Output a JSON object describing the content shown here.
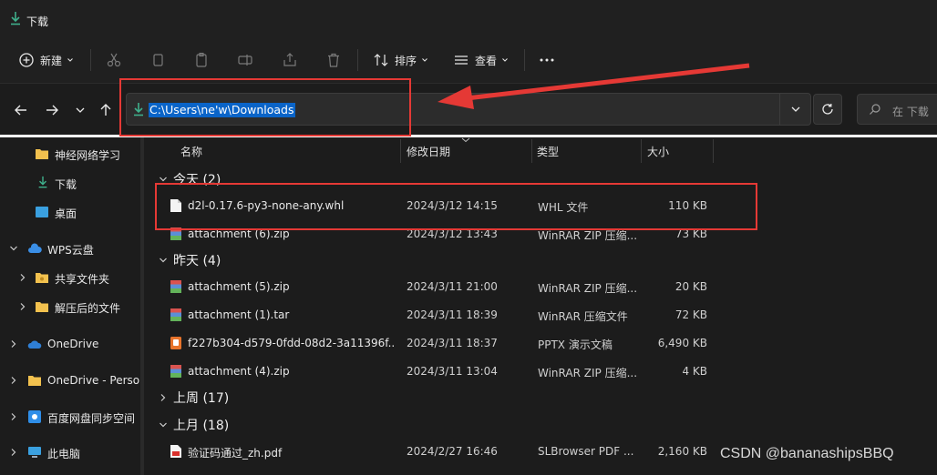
{
  "window": {
    "title": "下载"
  },
  "toolbar": {
    "new_label": "新建",
    "sort_label": "排序",
    "view_label": "查看"
  },
  "address": {
    "path": "C:\\Users\\ne'w\\Downloads"
  },
  "search": {
    "placeholder": "在 下载 "
  },
  "sidebar": {
    "items": [
      {
        "label": "神经网络学习",
        "icon": "folder-icon"
      },
      {
        "label": "下载",
        "icon": "download-icon"
      },
      {
        "label": "桌面",
        "icon": "desktop-icon"
      },
      {
        "label": "WPS云盘",
        "icon": "cloud-icon"
      },
      {
        "label": "共享文件夹",
        "icon": "shared-folder-icon"
      },
      {
        "label": "解压后的文件",
        "icon": "folder-icon"
      },
      {
        "label": "OneDrive",
        "icon": "onedrive-icon"
      },
      {
        "label": "OneDrive - Perso",
        "icon": "folder-icon"
      },
      {
        "label": "百度网盘同步空间",
        "icon": "baidu-icon"
      },
      {
        "label": "此电脑",
        "icon": "pc-icon"
      }
    ]
  },
  "columns": {
    "name": "名称",
    "date": "修改日期",
    "type": "类型",
    "size": "大小"
  },
  "groups": {
    "today": "今天 (2)",
    "yesterday": "昨天 (4)",
    "last_week": "上周 (17)",
    "last_month": "上月 (18)"
  },
  "files": [
    {
      "name": "d2l-0.17.6-py3-none-any.whl",
      "date": "2024/3/12 14:15",
      "type": "WHL 文件",
      "size": "110 KB",
      "icon": "file-icon"
    },
    {
      "name": "attachment (6).zip",
      "date": "2024/3/12 13:43",
      "type": "WinRAR ZIP 压缩...",
      "size": "73 KB",
      "icon": "winrar-icon"
    },
    {
      "name": "attachment (5).zip",
      "date": "2024/3/11 21:00",
      "type": "WinRAR ZIP 压缩...",
      "size": "20 KB",
      "icon": "winrar-icon"
    },
    {
      "name": "attachment (1).tar",
      "date": "2024/3/11 18:39",
      "type": "WinRAR 压缩文件",
      "size": "72 KB",
      "icon": "winrar-icon"
    },
    {
      "name": "f227b304-d579-0fdd-08d2-3a11396f...",
      "date": "2024/3/11 18:37",
      "type": "PPTX 演示文稿",
      "size": "6,490 KB",
      "icon": "pptx-icon"
    },
    {
      "name": "attachment (4).zip",
      "date": "2024/3/11 13:04",
      "type": "WinRAR ZIP 压缩...",
      "size": "4 KB",
      "icon": "winrar-icon"
    },
    {
      "name": "验证码通过_zh.pdf",
      "date": "2024/2/27 16:46",
      "type": "SLBrowser PDF ...",
      "size": "2,160 KB",
      "icon": "pdf-icon"
    }
  ],
  "watermark": "CSDN @bananashipsBBQ",
  "colors": {
    "accent": "#0a64c8",
    "annotation": "#e53935",
    "background": "#1c1c1c"
  }
}
